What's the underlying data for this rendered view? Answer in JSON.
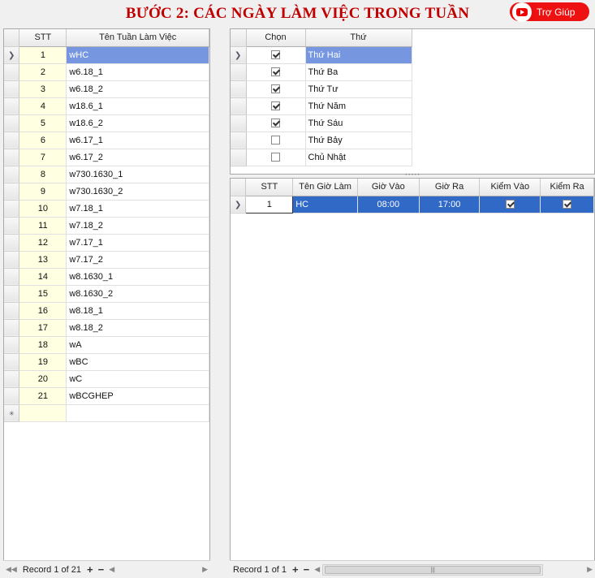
{
  "title": "BƯỚC 2: CÁC NGÀY LÀM VIỆC TRONG TUẦN",
  "help_label": "Trợ Giúp",
  "weeks": {
    "headers": {
      "stt": "STT",
      "name": "Tên Tuần Làm Việc"
    },
    "rows": [
      {
        "stt": "1",
        "name": "wHC"
      },
      {
        "stt": "2",
        "name": "w6.18_1"
      },
      {
        "stt": "3",
        "name": "w6.18_2"
      },
      {
        "stt": "4",
        "name": "w18.6_1"
      },
      {
        "stt": "5",
        "name": "w18.6_2"
      },
      {
        "stt": "6",
        "name": "w6.17_1"
      },
      {
        "stt": "7",
        "name": "w6.17_2"
      },
      {
        "stt": "8",
        "name": "w730.1630_1"
      },
      {
        "stt": "9",
        "name": "w730.1630_2"
      },
      {
        "stt": "10",
        "name": "w7.18_1"
      },
      {
        "stt": "11",
        "name": "w7.18_2"
      },
      {
        "stt": "12",
        "name": "w7.17_1"
      },
      {
        "stt": "13",
        "name": "w7.17_2"
      },
      {
        "stt": "14",
        "name": "w8.1630_1"
      },
      {
        "stt": "15",
        "name": "w8.1630_2"
      },
      {
        "stt": "16",
        "name": "w8.18_1"
      },
      {
        "stt": "17",
        "name": "w8.18_2"
      },
      {
        "stt": "18",
        "name": "wA"
      },
      {
        "stt": "19",
        "name": "wBC"
      },
      {
        "stt": "20",
        "name": "wC"
      },
      {
        "stt": "21",
        "name": "wBCGHEP"
      }
    ],
    "record_text": "Record 1 of 21"
  },
  "days": {
    "headers": {
      "chon": "Chọn",
      "thu": "Thứ"
    },
    "rows": [
      {
        "day": "Thứ Hai",
        "checked": true
      },
      {
        "day": "Thứ Ba",
        "checked": true
      },
      {
        "day": "Thứ Tư",
        "checked": true
      },
      {
        "day": "Thứ Năm",
        "checked": true
      },
      {
        "day": "Thứ Sáu",
        "checked": true
      },
      {
        "day": "Thứ Bảy",
        "checked": false
      },
      {
        "day": "Chủ Nhật",
        "checked": false
      }
    ]
  },
  "hours": {
    "headers": {
      "stt": "STT",
      "name": "Tên Giờ Làm",
      "in": "Giờ Vào",
      "out": "Giờ Ra",
      "check_in": "Kiểm Vào",
      "check_out": "Kiểm Ra"
    },
    "rows": [
      {
        "stt": "1",
        "name": "HC",
        "in": "08:00",
        "out": "17:00",
        "check_in": true,
        "check_out": true
      }
    ],
    "record_text": "Record 1 of 1"
  },
  "icons": {
    "row_pointer": "row-pointer-icon",
    "new_row": "new-row-icon",
    "help": "youtube-icon"
  },
  "colors": {
    "title": "#c00000",
    "help_button": "#ee1111",
    "selected_row": "#3169c6",
    "selected_cell": "#7697e0",
    "stt_background": "#ffffe1"
  }
}
